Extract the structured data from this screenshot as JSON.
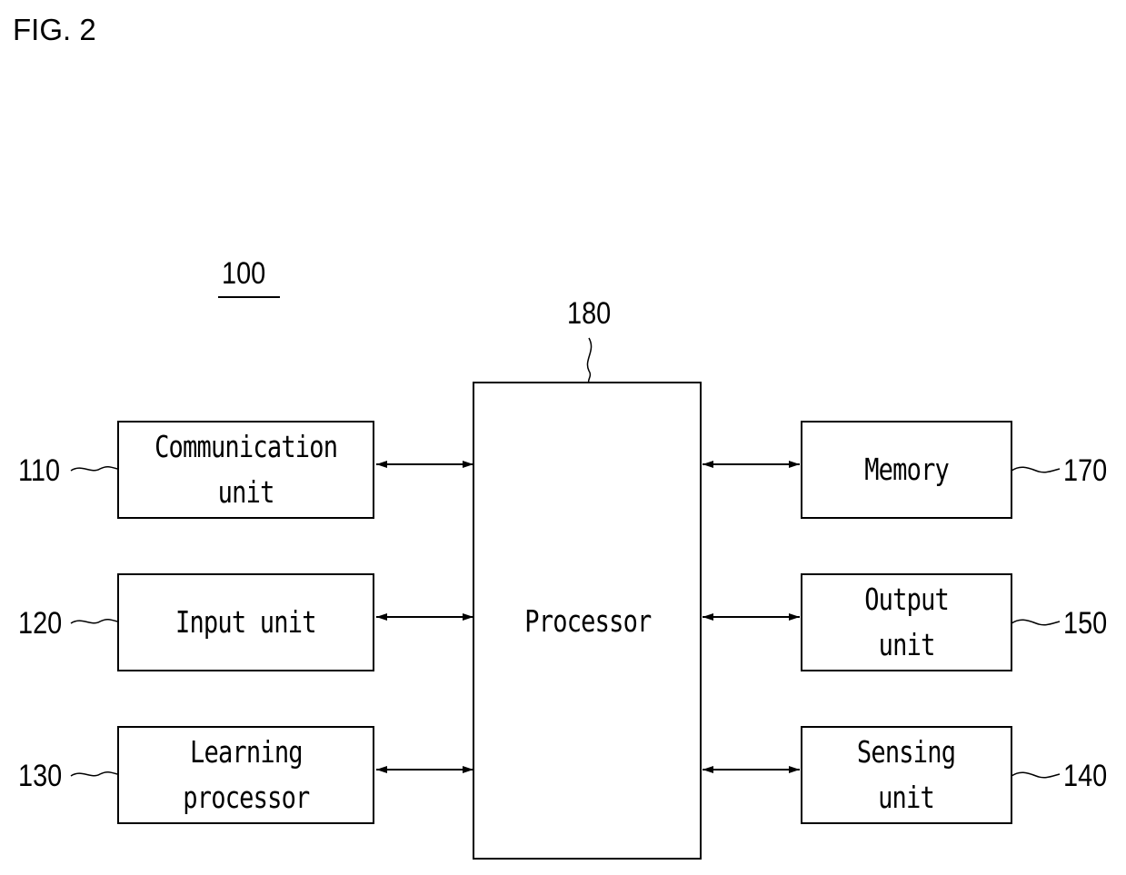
{
  "figure": {
    "title": "FIG. 2",
    "system_ref": "100"
  },
  "processor": {
    "label": "Processor",
    "ref": "180"
  },
  "left_units": [
    {
      "label": "Communication\nunit",
      "ref": "110"
    },
    {
      "label": "Input unit",
      "ref": "120"
    },
    {
      "label": "Learning\nprocessor",
      "ref": "130"
    }
  ],
  "right_units": [
    {
      "label": "Memory",
      "ref": "170"
    },
    {
      "label": "Output\nunit",
      "ref": "150"
    },
    {
      "label": "Sensing\nunit",
      "ref": "140"
    }
  ],
  "connections": "bidirectional"
}
